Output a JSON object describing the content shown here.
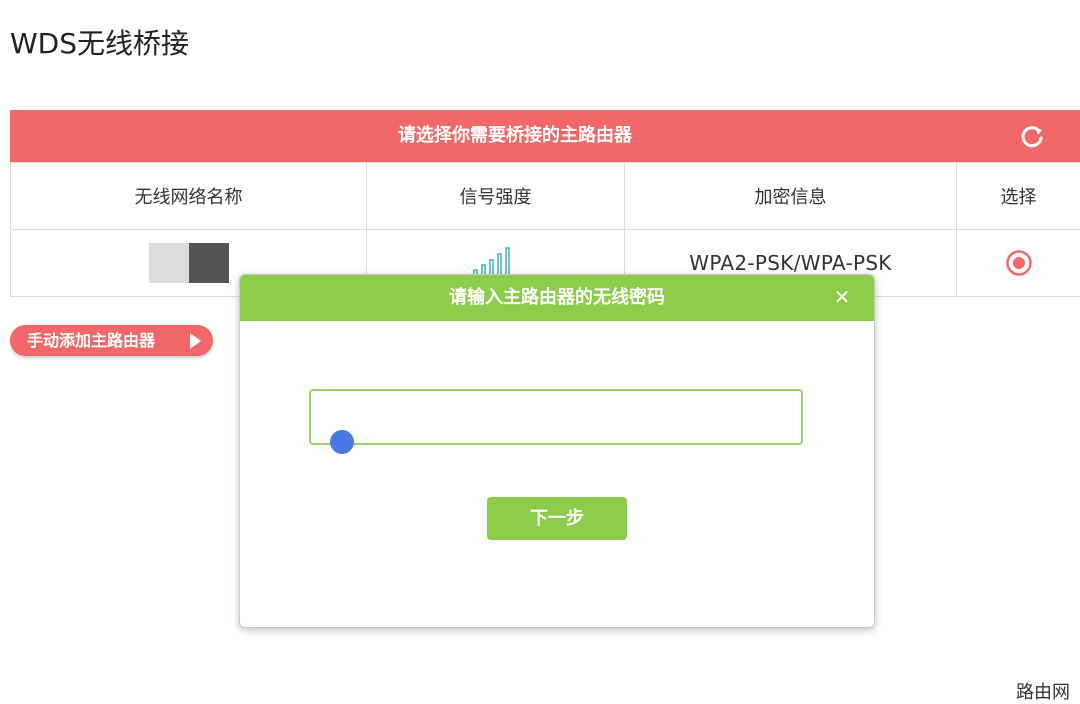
{
  "page": {
    "title": "WDS无线桥接"
  },
  "panel": {
    "header": "请选择你需要桥接的主路由器",
    "refresh_icon": "refresh-icon",
    "colors": {
      "header_bg": "#f26767"
    }
  },
  "table": {
    "headers": [
      "无线网络名称",
      "信号强度",
      "加密信息",
      "选择"
    ],
    "rows": [
      {
        "encryption": "WPA2-PSK/WPA-PSK",
        "signal_icon": "signal-strength-icon",
        "selected": true
      }
    ]
  },
  "manual_add": {
    "label": "手动添加主路由器",
    "icon": "play-arrow-icon"
  },
  "dialog": {
    "title": "请输入主路由器的无线密码",
    "close_icon": "close-icon",
    "password": {
      "value": "",
      "placeholder": ""
    },
    "next_label": "下一步",
    "colors": {
      "header_bg": "#8bcd4b"
    }
  },
  "watermark": "路由网"
}
